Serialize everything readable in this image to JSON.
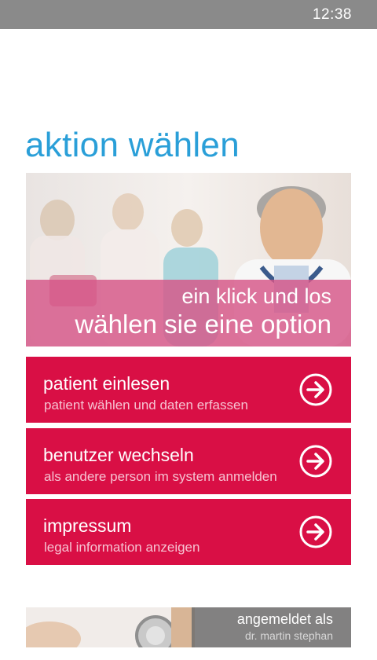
{
  "status_bar": {
    "time": "12:38"
  },
  "page": {
    "title": "aktion wählen"
  },
  "hero": {
    "line1": "ein klick und los",
    "line2": "wählen sie eine option"
  },
  "tiles": [
    {
      "title": "patient einlesen",
      "subtitle": "patient wählen und daten erfassen",
      "icon": "arrow-right-circle-icon"
    },
    {
      "title": "benutzer wechseln",
      "subtitle": "als andere person im system anmelden",
      "icon": "arrow-right-circle-icon"
    },
    {
      "title": "impressum",
      "subtitle": "legal information anzeigen",
      "icon": "arrow-right-circle-icon"
    }
  ],
  "footer": {
    "label": "angemeldet als",
    "user": "dr. martin stephan"
  },
  "colors": {
    "accent_title": "#2a9fd8",
    "tile_bg": "#d90f45",
    "hero_overlay": "#d65687",
    "status_bar": "#8a8a8a"
  }
}
